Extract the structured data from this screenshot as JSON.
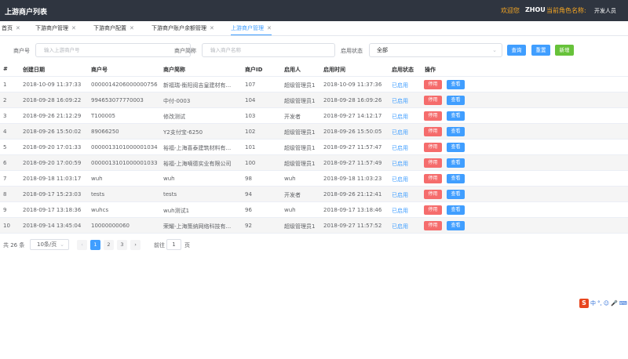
{
  "header": {
    "title": "上游商户列表",
    "welcome": "欢迎您",
    "username": "ZHOU",
    "role_label": "当前角色名称:",
    "role_value": "开发人员"
  },
  "tabs": [
    {
      "label": "首页",
      "close": "✕"
    },
    {
      "label": "下游商户管理",
      "close": "✕"
    },
    {
      "label": "下游商户配置",
      "close": "✕"
    },
    {
      "label": "下游商户账户余额管理",
      "close": "✕"
    },
    {
      "label": "上游商户管理",
      "close": "✕"
    }
  ],
  "filters": {
    "merchant_no_label": "商户号",
    "merchant_no_placeholder": "输入上游商户号",
    "merchant_name_label": "商户简称",
    "merchant_name_placeholder": "输入商户名称",
    "status_label": "启用状态",
    "status_value": "全部",
    "query_button": "查询",
    "reset_button": "重置",
    "add_button": "新增"
  },
  "table": {
    "columns": [
      "#",
      "创建日期",
      "商户号",
      "商户简称",
      "商户ID",
      "启用人",
      "启用时间",
      "启用状态",
      "操作"
    ],
    "disable_label": "停用",
    "view_label": "查看",
    "rows": [
      {
        "idx": "1",
        "created": "2018-10-09 11:37:33",
        "merchant_no": "0000014206000000756",
        "name": "新福瑞-衡阳阅吉皇建材有...",
        "id": "107",
        "enabler": "超级管理员1",
        "enabled_time": "2018-10-09 11:37:36",
        "status": "已启用"
      },
      {
        "idx": "2",
        "created": "2018-09-28 16:09:22",
        "merchant_no": "994653077770003",
        "name": "中付-0003",
        "id": "104",
        "enabler": "超级管理员1",
        "enabled_time": "2018-09-28 16:09:26",
        "status": "已启用"
      },
      {
        "idx": "3",
        "created": "2018-09-26 21:12:29",
        "merchant_no": "T100005",
        "name": "修改测试",
        "id": "103",
        "enabler": "开发者",
        "enabled_time": "2018-09-27 14:12:17",
        "status": "已启用"
      },
      {
        "idx": "4",
        "created": "2018-09-26 15:50:02",
        "merchant_no": "89066250",
        "name": "Y2支付宝-6250",
        "id": "102",
        "enabler": "超级管理员1",
        "enabled_time": "2018-09-26 15:50:05",
        "status": "已启用"
      },
      {
        "idx": "5",
        "created": "2018-09-20 17:01:33",
        "merchant_no": "0000013101000001034",
        "name": "裕福-上海喜泰建筑材料有...",
        "id": "101",
        "enabler": "超级管理员1",
        "enabled_time": "2018-09-27 11:57:47",
        "status": "已启用"
      },
      {
        "idx": "6",
        "created": "2018-09-20 17:00:59",
        "merchant_no": "0000013101000001033",
        "name": "裕福-上海嘀德实业有限公司",
        "id": "100",
        "enabler": "超级管理员1",
        "enabled_time": "2018-09-27 11:57:49",
        "status": "已启用"
      },
      {
        "idx": "7",
        "created": "2018-09-18 11:03:17",
        "merchant_no": "wuh",
        "name": "wuh",
        "id": "98",
        "enabler": "wuh",
        "enabled_time": "2018-09-18 11:03:23",
        "status": "已启用"
      },
      {
        "idx": "8",
        "created": "2018-09-17 15:23:03",
        "merchant_no": "tests",
        "name": "tests",
        "id": "94",
        "enabler": "开发者",
        "enabled_time": "2018-09-26 21:12:41",
        "status": "已启用"
      },
      {
        "idx": "9",
        "created": "2018-09-17 13:18:36",
        "merchant_no": "wuhcs",
        "name": "wuh测试1",
        "id": "96",
        "enabler": "wuh",
        "enabled_time": "2018-09-17 13:18:46",
        "status": "已启用"
      },
      {
        "idx": "10",
        "created": "2018-09-14 13:45:04",
        "merchant_no": "10000000060",
        "name": "荣耀-上海策纳网络科技有...",
        "id": "92",
        "enabler": "超级管理员1",
        "enabled_time": "2018-09-27 11:57:52",
        "status": "已启用"
      }
    ]
  },
  "pagination": {
    "total": "共 26 条",
    "page_size": "10条/页",
    "prev": "‹",
    "next": "›",
    "pages": [
      "1",
      "2",
      "3"
    ],
    "goto_label": "前往",
    "goto_value": "1",
    "goto_unit": "页"
  },
  "ime": {
    "logo": "S",
    "items": [
      "中",
      "°,",
      "☺",
      "🎤",
      "⌨"
    ]
  }
}
